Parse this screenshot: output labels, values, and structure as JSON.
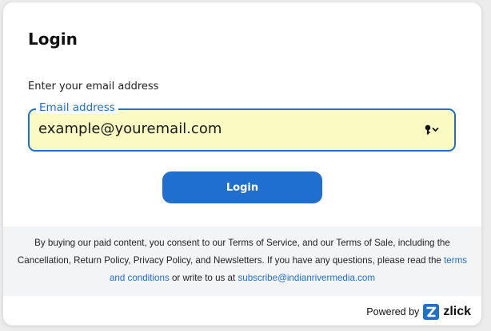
{
  "header": {
    "title": "Login"
  },
  "form": {
    "prompt": "Enter your email address",
    "email_label": "Email address",
    "email_value": "example@youremail.com",
    "key_icon": "key-icon",
    "dropdown_icon": "chevron-down-icon",
    "submit_label": "Login",
    "accent_color": "#1f6fd1",
    "autofill_color": "#fafbc3"
  },
  "terms": {
    "text_before": "By buying our paid content, you consent to our Terms of Service, and our Terms of Sale, including the Cancellation, Return Policy, Privacy Policy, and Newsletters. If you have any questions, please read the ",
    "terms_link": "terms and conditions",
    "text_middle": " or write to us at ",
    "email_link": "subscribe@indianrivermedia.com"
  },
  "footer": {
    "powered_by": "Powered by",
    "brand_logo": "zlick-logo",
    "brand_name": "zlick"
  }
}
